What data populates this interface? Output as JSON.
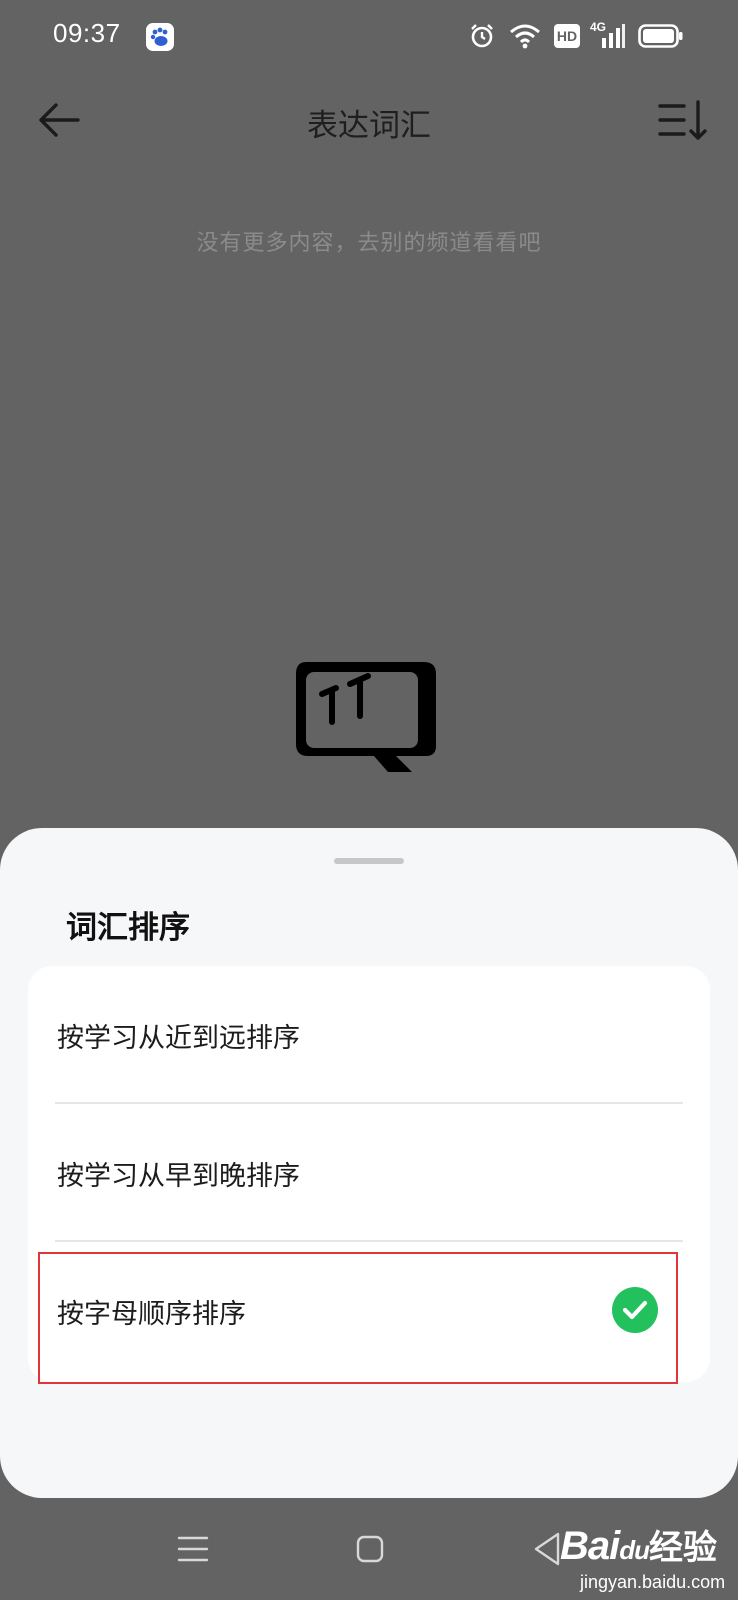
{
  "status_bar": {
    "time": "09:37",
    "icons": [
      "baidu-app-icon",
      "alarm-icon",
      "wifi-icon",
      "hd-icon",
      "signal-4g-icon",
      "battery-icon"
    ],
    "hd_label": "HD",
    "network_label": "4G"
  },
  "header": {
    "title": "表达词汇",
    "back_icon": "arrow-left-icon",
    "sort_icon": "sort-icon"
  },
  "empty_state": {
    "message": "没有更多内容，去别的频道看看吧",
    "illustration": "empty-face-icon"
  },
  "sort_sheet": {
    "title": "词汇排序",
    "options": [
      {
        "label": "按学习从近到远排序",
        "selected": false
      },
      {
        "label": "按学习从早到晚排序",
        "selected": false
      },
      {
        "label": "按字母顺序排序",
        "selected": true
      }
    ],
    "selected_color": "#22c15e",
    "highlight_color": "#e0363b"
  },
  "nav_bar": {
    "icons": [
      "menu-icon",
      "home-icon",
      "back-triangle-icon"
    ]
  },
  "watermark": {
    "logo_text": "Bai",
    "logo_suffix": "du",
    "product": "经验",
    "url": "jingyan.baidu.com"
  }
}
